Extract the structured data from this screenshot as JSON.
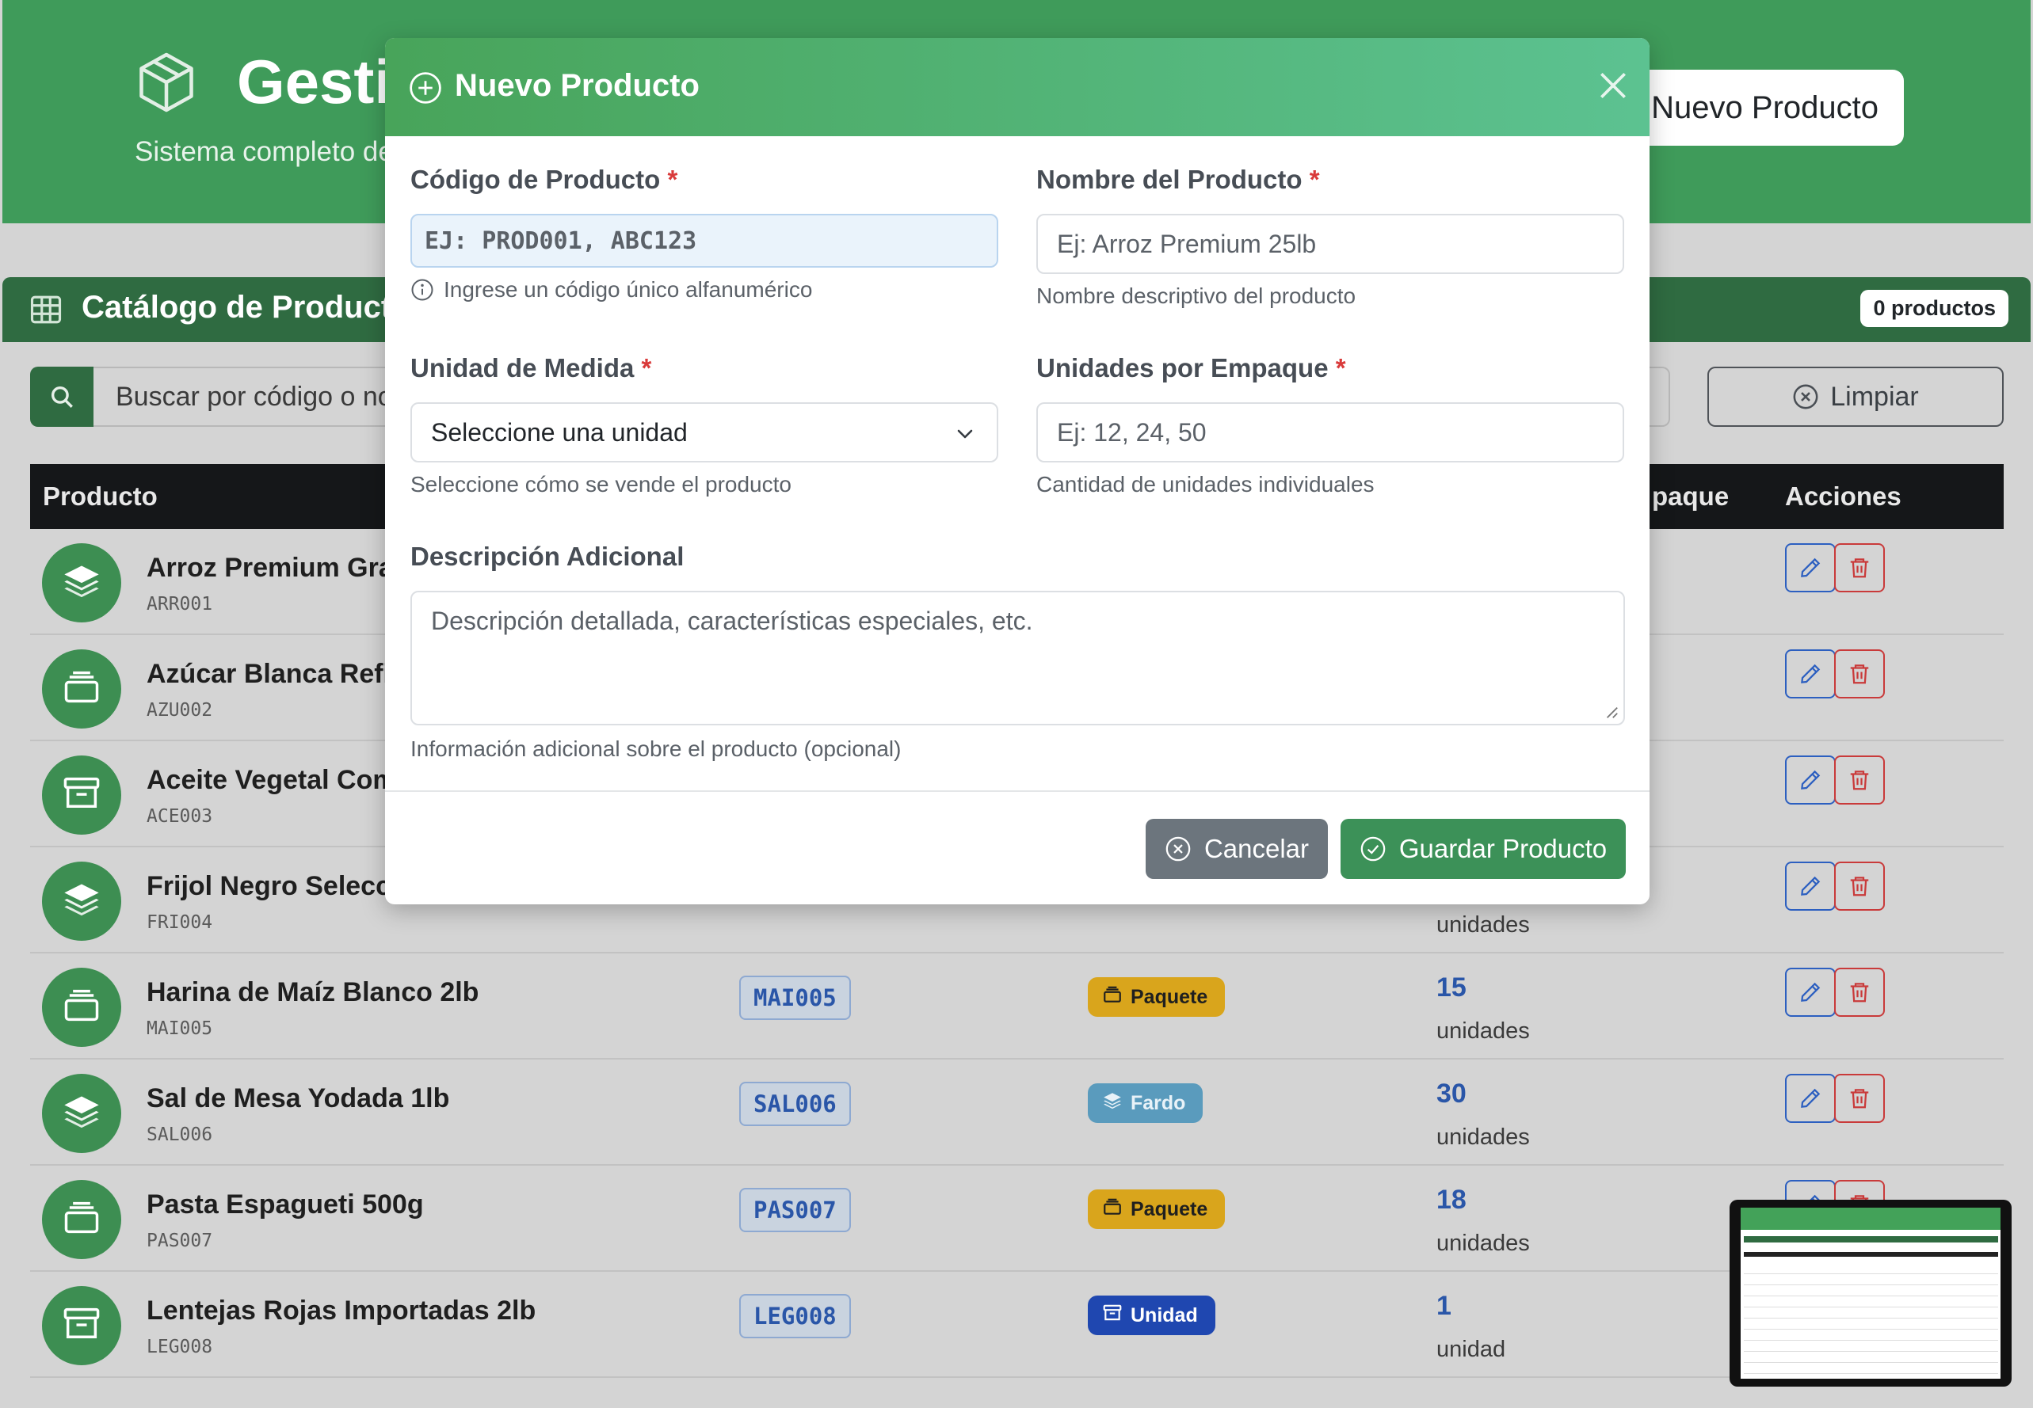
{
  "header": {
    "title": "Gesti",
    "subtitle": "Sistema completo de",
    "new_product_button": "Nuevo Producto"
  },
  "catalog": {
    "title": "Catálogo de Producto",
    "count_badge": "0 productos",
    "search_placeholder": "Buscar por código o no",
    "clear_button": "Limpiar",
    "columns": {
      "product": "Producto",
      "package": "paque",
      "actions": "Acciones"
    },
    "rows": [
      {
        "name": "Arroz Premium Gran",
        "code": "ARR001",
        "chip": "",
        "unit": "",
        "unit_type": "",
        "qty": "",
        "qty_label": "",
        "icon": "layers-icon"
      },
      {
        "name": "Azúcar Blanca Refin",
        "code": "AZU002",
        "chip": "",
        "unit": "",
        "unit_type": "",
        "qty": "",
        "qty_label": "",
        "icon": "package-icon"
      },
      {
        "name": "Aceite Vegetal Com",
        "code": "ACE003",
        "chip": "",
        "unit": "",
        "unit_type": "",
        "qty": "",
        "qty_label": "",
        "icon": "archive-icon"
      },
      {
        "name": "Frijol Negro Selecci",
        "code": "FRI004",
        "chip": "",
        "unit": "",
        "unit_type": "",
        "qty": "",
        "qty_label": "unidades",
        "icon": "layers-icon"
      },
      {
        "name": "Harina de Maíz Blanco 2lb",
        "code": "MAI005",
        "chip": "MAI005",
        "unit": "Paquete",
        "unit_type": "paquete",
        "qty": "15",
        "qty_label": "unidades",
        "icon": "package-icon"
      },
      {
        "name": "Sal de Mesa Yodada 1lb",
        "code": "SAL006",
        "chip": "SAL006",
        "unit": "Fardo",
        "unit_type": "fardo",
        "qty": "30",
        "qty_label": "unidades",
        "icon": "layers-icon"
      },
      {
        "name": "Pasta Espagueti 500g",
        "code": "PAS007",
        "chip": "PAS007",
        "unit": "Paquete",
        "unit_type": "paquete",
        "qty": "18",
        "qty_label": "unidades",
        "icon": "package-icon"
      },
      {
        "name": "Lentejas Rojas Importadas 2lb",
        "code": "LEG008",
        "chip": "LEG008",
        "unit": "Unidad",
        "unit_type": "unidad",
        "qty": "1",
        "qty_label": "unidad",
        "icon": "archive-icon"
      }
    ]
  },
  "modal": {
    "title": "Nuevo Producto",
    "code_label": "Código de Producto",
    "code_placeholder": "EJ: PROD001, ABC123",
    "code_help": "Ingrese un código único alfanumérico",
    "name_label": "Nombre del Producto",
    "name_placeholder": "Ej: Arroz Premium 25lb",
    "name_help": "Nombre descriptivo del producto",
    "unit_label": "Unidad de Medida",
    "unit_selected": "Seleccione una unidad",
    "unit_help": "Seleccione cómo se vende el producto",
    "per_pack_label": "Unidades por Empaque",
    "per_pack_placeholder": "Ej: 12, 24, 50",
    "per_pack_help": "Cantidad de unidades individuales",
    "desc_label": "Descripción Adicional",
    "desc_placeholder": "Descripción detallada, características especiales, etc.",
    "desc_help": "Información adicional sobre el producto (opcional)",
    "required_mark": "*",
    "cancel_button": "Cancelar",
    "save_button": "Guardar Producto"
  },
  "colors": {
    "brand_green": "#3f9b5a",
    "dark_green": "#2f6b41",
    "modal_gradient_start": "#48a45a",
    "modal_gradient_end": "#5cc291",
    "required": "#d93a3a",
    "save_button": "#3c9158",
    "cancel_button": "#6c757d",
    "paquete_badge": "#d9a51c",
    "fardo_badge": "#5a9bbd",
    "unidad_badge": "#1f47b0"
  }
}
